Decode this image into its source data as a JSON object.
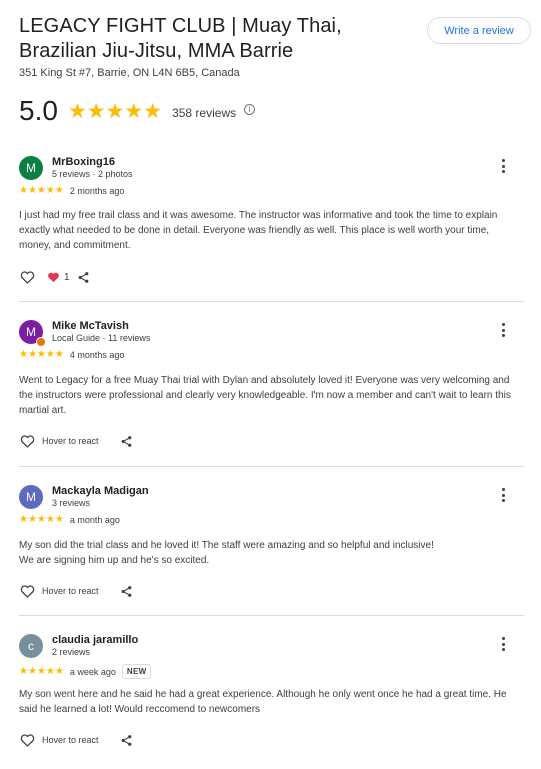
{
  "place": {
    "title_line1": "LEGACY FIGHT CLUB | Muay Thai,",
    "title_line2": "Brazilian Jiu-Jitsu, MMA Barrie",
    "address": "351 King St #7, Barrie, ON L4N 6B5, Canada",
    "write_review_label": "Write a review",
    "rating": "5.0",
    "rating_stars": "★★★★★",
    "review_count": "358 reviews",
    "info_icon": "ⓘ"
  },
  "reviews": [
    {
      "avatar_letter": "M",
      "avatar_color": "#0b8043",
      "name": "MrBoxing16",
      "meta": "5 reviews · 2 photos",
      "stars": "★★★★★",
      "when": "2 months ago",
      "text": "I just had my free trail class and it was awesome. The instructor was informative and took the time to explain exactly what needed to be done in detail. Everyone was friendly as well. This place is well worth your time, money, and commitment.",
      "reaction_count": "1"
    },
    {
      "avatar_letter": "M",
      "avatar_color": "#7b1fa2",
      "name": "Mike McTavish",
      "meta": "Local Guide · 11 reviews",
      "stars": "★★★★★",
      "when": "4 months ago",
      "text": "Went to Legacy for a free Muay Thai trial with Dylan and absolutely loved it! Everyone was very welcoming and the instructors were professional and clearly very knowledgeable. I'm now a member and can't wait to learn this martial art.",
      "react_label": "Hover to react"
    },
    {
      "avatar_letter": "M",
      "avatar_color": "#5c6bc0",
      "name": "Mackayla Madigan",
      "meta": "3 reviews",
      "stars": "★★★★★",
      "when": "a month ago",
      "text_line1": "My son did the trial class and he loved it! The staff were amazing and so helpful and inclusive!",
      "text_line2": "We are signing him up and he's so excited.",
      "react_label": "Hover to react"
    },
    {
      "avatar_letter": "c",
      "avatar_color": "#78909c",
      "name": "claudia jaramillo",
      "meta": "2 reviews",
      "stars": "★★★★★",
      "when": "a week ago",
      "badge": "NEW",
      "text": "My son went here and he said he had a great experience. Although he only went once he had a great time. He said he learned a lot! Would reccomend to newcomers",
      "react_label": "Hover to react"
    }
  ]
}
